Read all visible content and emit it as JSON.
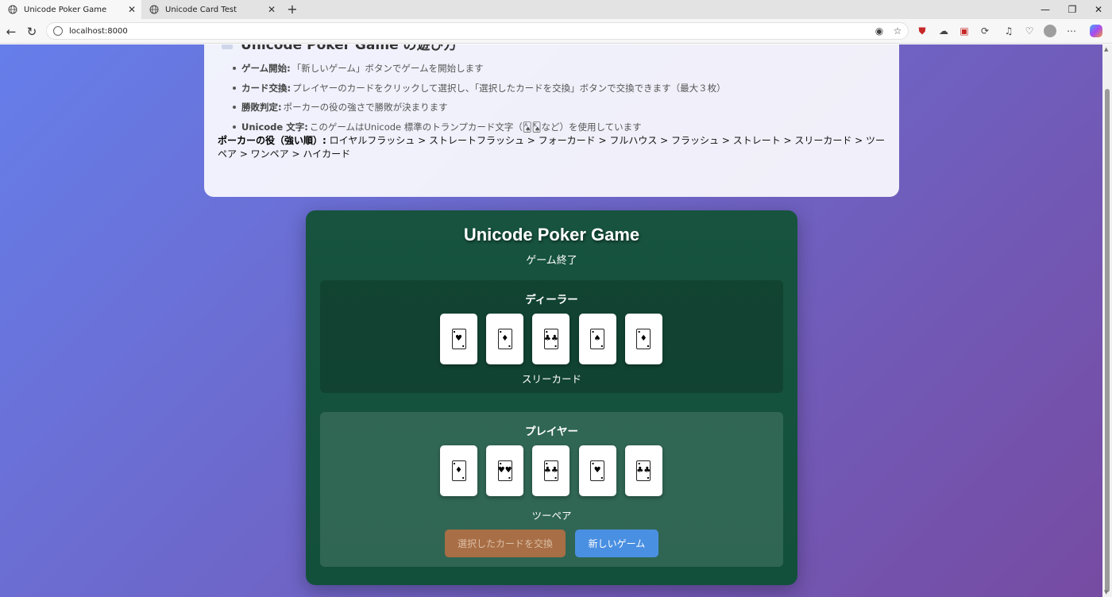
{
  "browser": {
    "tabs": [
      {
        "title": "Unicode Poker Game",
        "active": true
      },
      {
        "title": "Unicode Card Test",
        "active": false
      }
    ],
    "url": "localhost:8000",
    "window_controls": {
      "minimize": "—",
      "restore": "❐",
      "close": "✕"
    }
  },
  "howto": {
    "title": "Unicode Poker Game の遊び方",
    "items": [
      {
        "term": "ゲーム開始:",
        "text": " 「新しいゲーム」ボタンでゲームを開始します"
      },
      {
        "term": "カード交換:",
        "text": " プレイヤーのカードをクリックして選択し、「選択したカードを交換」ボタンで交換できます（最大３枚）"
      },
      {
        "term": "勝敗判定:",
        "text": " ポーカーの役の強さで勝敗が決まります"
      },
      {
        "term": "Unicode 文字:",
        "text": " このゲームはUnicode 標準のトランプカード文字（🂡🂮など）を使用しています"
      }
    ],
    "hands_label": "ポーカーの役（強い順）:",
    "hands_text": " ロイヤルフラッシュ > ストレートフラッシュ > フォーカード > フルハウス > フラッシュ > ストレート > スリーカード > ツーペア > ワンペア > ハイカード"
  },
  "game": {
    "title": "Unicode Poker Game",
    "status": "ゲーム終了",
    "dealer": {
      "label": "ディーラー",
      "cards": [
        {
          "pip": "♥"
        },
        {
          "pip": "♦"
        },
        {
          "pip": "♣♣"
        },
        {
          "pip": "♠"
        },
        {
          "pip": "♦"
        }
      ],
      "hand_rank": "スリーカード"
    },
    "player": {
      "label": "プレイヤー",
      "cards": [
        {
          "pip": "♦"
        },
        {
          "pip": "♥♥"
        },
        {
          "pip": "♣♣"
        },
        {
          "pip": "♥"
        },
        {
          "pip": "♣♣"
        }
      ],
      "hand_rank": "ツーペア"
    },
    "buttons": {
      "exchange": "選択したカードを交換",
      "new_game": "新しいゲーム"
    },
    "colors": {
      "table": "#17533e",
      "exchange_button": "#a86e45",
      "new_game_button": "#4a90e2",
      "background_start": "#667eea",
      "background_end": "#764ba2"
    }
  }
}
